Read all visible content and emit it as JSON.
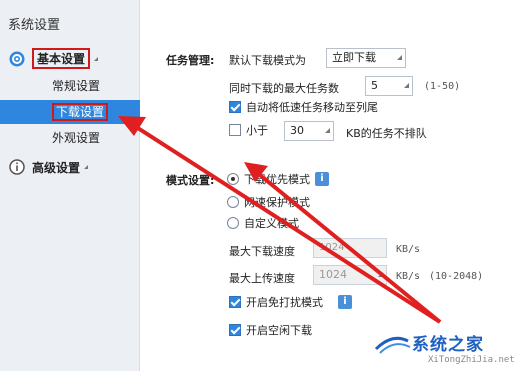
{
  "sidebar": {
    "title": "系统设置",
    "basic_group": "基本设置",
    "items": [
      "常规设置",
      "下载设置",
      "外观设置"
    ],
    "advanced_group": "高级设置"
  },
  "task": {
    "section_label": "任务管理:",
    "default_mode_label": "默认下载模式为",
    "default_mode_value": "立即下载",
    "max_tasks_label": "同时下载的最大任务数",
    "max_tasks_value": "5",
    "max_tasks_hint": "(1-50)",
    "auto_move_label": "自动将低速任务移动至列尾",
    "auto_move_checked": true,
    "less_than_label": "小于",
    "less_than_value": "30",
    "less_than_suffix": "KB的任务不排队",
    "less_than_checked": false
  },
  "mode": {
    "section_label": "模式设置:",
    "options": [
      "下载优先模式",
      "网速保护模式",
      "自定义模式"
    ],
    "selected": 0,
    "max_down_label": "最大下载速度",
    "max_down_value": "1024",
    "max_down_unit": "KB/s",
    "max_up_label": "最大上传速度",
    "max_up_value": "1024",
    "max_up_unit": "KB/s",
    "max_up_hint": "(10-2048)",
    "no_disturb_label": "开启免打扰模式",
    "no_disturb_checked": true,
    "idle_download_label": "开启空闲下载",
    "idle_download_checked": true
  },
  "watermark": {
    "brand": "系统之家",
    "url": "XiTongZhiJia.net"
  },
  "colors": {
    "selected_bg": "#2f86de",
    "highlight_box": "#d01a1a",
    "arrow": "#e02020",
    "watermark": "#1e5fbf"
  }
}
